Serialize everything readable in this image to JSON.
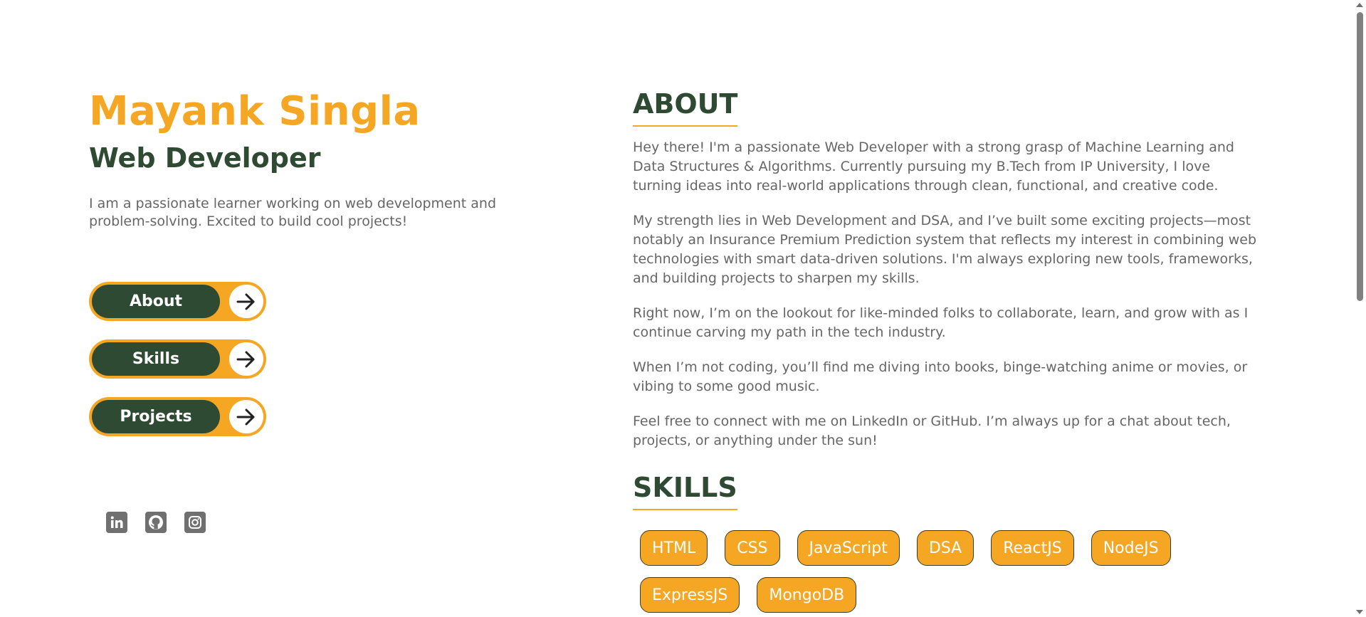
{
  "hero": {
    "name": "Mayank Singla",
    "role": "Web Developer",
    "bio": "I am a passionate learner working on web development and problem-solving. Excited to build cool projects!"
  },
  "nav": [
    {
      "label": "About",
      "icon": "arrow-right-icon"
    },
    {
      "label": "Skills",
      "icon": "arrow-right-icon"
    },
    {
      "label": "Projects",
      "icon": "arrow-right-icon"
    }
  ],
  "socials": [
    {
      "name": "linkedin-icon"
    },
    {
      "name": "github-icon"
    },
    {
      "name": "instagram-icon"
    }
  ],
  "about": {
    "title": "ABOUT",
    "paragraphs": [
      "Hey there! I'm a passionate Web Developer with a strong grasp of Machine Learning and Data Structures & Algorithms. Currently pursuing my B.Tech from IP University, I love turning ideas into real-world applications through clean, functional, and creative code.",
      "My strength lies in Web Development and DSA, and I’ve built some exciting projects—most notably an Insurance Premium Prediction system that reflects my interest in combining web technologies with smart data-driven solutions. I'm always exploring new tools, frameworks, and building projects to sharpen my skills.",
      "Right now, I’m on the lookout for like-minded folks to collaborate, learn, and grow with as I continue carving my path in the tech industry.",
      "When I’m not coding, you’ll find me diving into books, binge-watching anime or movies, or vibing to some good music.",
      "Feel free to connect with me on LinkedIn or GitHub. I’m always up for a chat about tech, projects, or anything under the sun!"
    ]
  },
  "skills": {
    "title": "SKILLS",
    "items": [
      "HTML",
      "CSS",
      "JavaScript",
      "DSA",
      "ReactJS",
      "NodeJS",
      "ExpressJS",
      "MongoDB"
    ]
  },
  "colors": {
    "accent": "#f5a623",
    "primary": "#2e4a32",
    "text_muted": "#666666",
    "icon_gray": "#707070"
  }
}
